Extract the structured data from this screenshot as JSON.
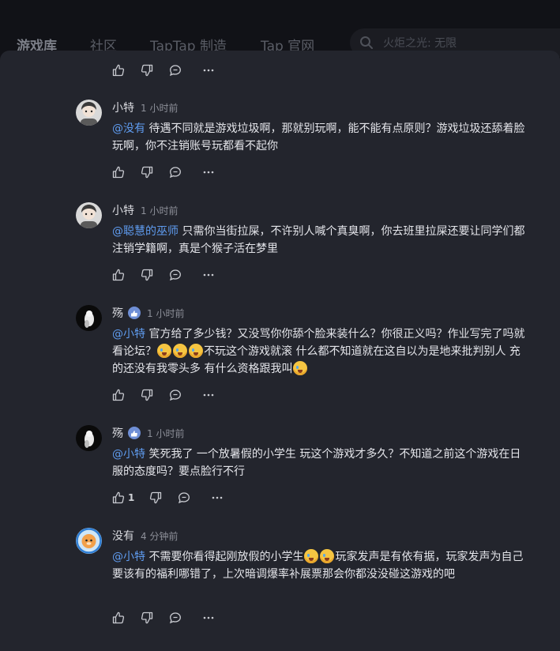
{
  "nav": {
    "items": [
      "游戏库",
      "社区",
      "TapTap 制造",
      "Tap 官网"
    ],
    "search_placeholder": "火炬之光: 无限"
  },
  "comments": [
    {
      "user": "小特",
      "time": "1 小时前",
      "mention": "@没有",
      "text": " 待遇不同就是游戏垃圾啊，那就别玩啊，能不能有点原则？游戏垃圾还舔着脸玩啊，你不注销账号玩都看不起你"
    },
    {
      "user": "小特",
      "time": "1 小时前",
      "mention": "@聪慧的巫师",
      "text": " 只需你当街拉屎，不许别人喊个真臭啊，你去班里拉屎还要让同学们都注销学籍啊，真是个猴子活在梦里"
    },
    {
      "user": "殇",
      "time": "1 小时前",
      "mention": "@小特",
      "text_a": " 官方给了多少钱？又没骂你你舔个脸来装什么？你很正义吗？作业写完了吗就看论坛？",
      "text_b": "不玩这个游戏就滚 什么都不知道就在这自以为是地来批判别人 充的还没有我零头多 有什么资格跟我叫"
    },
    {
      "user": "殇",
      "time": "1 小时前",
      "mention": "@小特",
      "text": " 笑死我了 一个放暑假的小学生 玩这个游戏才多久？不知道之前这个游戏在日服的态度吗？要点脸行不行",
      "likes": "1"
    },
    {
      "user": "没有",
      "time": "4 分钟前",
      "mention": "@小特",
      "text_a": " 不需要你看得起刚放假的小学生",
      "text_b": "玩家发声是有依有据，玩家发声为自己要该有的福利哪错了，上次暗调爆率补展票那会你都没没碰这游戏的吧"
    }
  ]
}
